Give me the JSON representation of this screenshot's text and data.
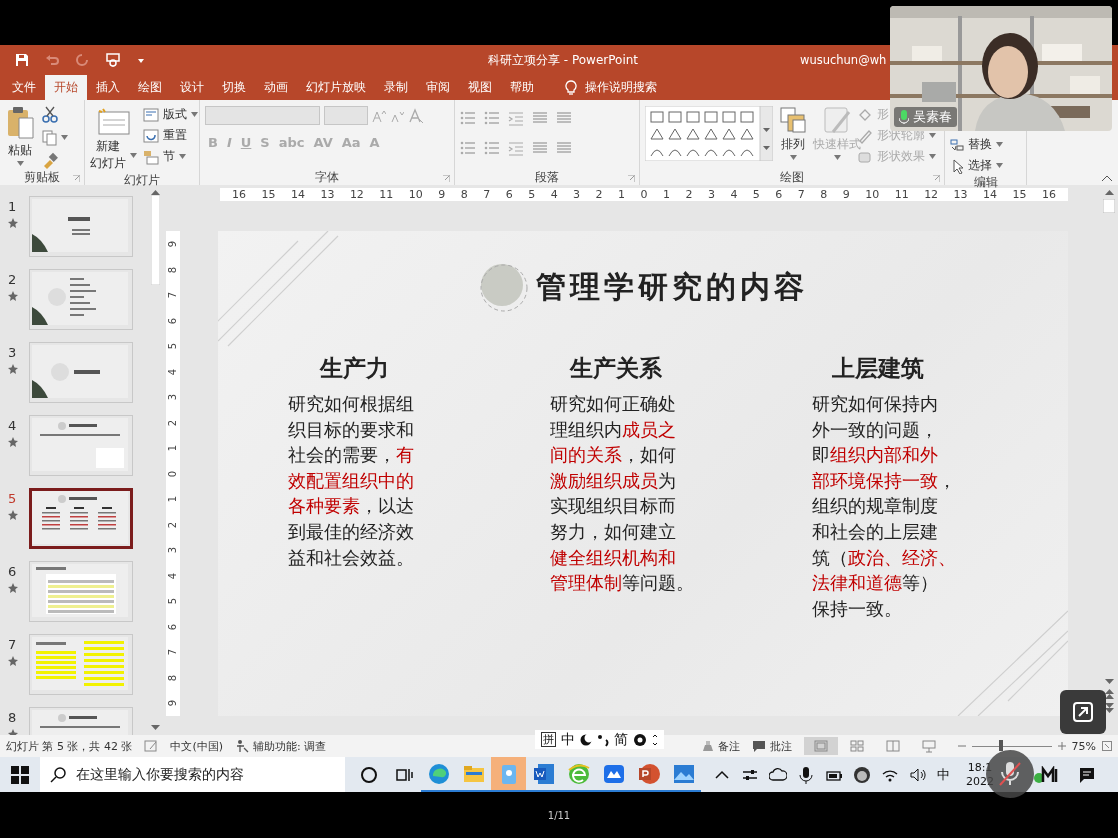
{
  "title_bar": {
    "title": "科研立项分享 - PowerPoint",
    "account": "wusuchun@wh"
  },
  "tabs": [
    {
      "label": "文件",
      "selected": false
    },
    {
      "label": "开始",
      "selected": true
    },
    {
      "label": "插入",
      "selected": false
    },
    {
      "label": "绘图",
      "selected": false
    },
    {
      "label": "设计",
      "selected": false
    },
    {
      "label": "切换",
      "selected": false
    },
    {
      "label": "动画",
      "selected": false
    },
    {
      "label": "幻灯片放映",
      "selected": false
    },
    {
      "label": "录制",
      "selected": false
    },
    {
      "label": "审阅",
      "selected": false
    },
    {
      "label": "视图",
      "selected": false
    },
    {
      "label": "帮助",
      "selected": false
    }
  ],
  "tell_me": "操作说明搜索",
  "ribbon": {
    "groups": [
      {
        "label": "剪贴板",
        "buttons": [
          {
            "label": "粘贴",
            "disabled": false
          }
        ]
      },
      {
        "label": "幻灯片",
        "buttons": [
          {
            "lines": [
              "新建",
              "幻灯片"
            ],
            "disabled": false
          },
          {
            "label": "版式",
            "disabled": false
          },
          {
            "label": "重置",
            "disabled": false
          },
          {
            "label": "节",
            "disabled": false
          }
        ]
      },
      {
        "label": "字体",
        "buttons": [
          {
            "label": "B",
            "disabled": true
          },
          {
            "label": "I",
            "disabled": true
          },
          {
            "label": "U",
            "disabled": true
          },
          {
            "label": "S",
            "disabled": true
          },
          {
            "label": "abc",
            "disabled": true
          },
          {
            "label": "AV",
            "disabled": true
          },
          {
            "label": "Aa",
            "disabled": true
          },
          {
            "label": "A",
            "disabled": true
          }
        ]
      },
      {
        "label": "段落"
      },
      {
        "label": "绘图",
        "buttons": [
          {
            "label": "排列",
            "disabled": false
          },
          {
            "label": "快速样式",
            "disabled": true
          },
          {
            "label": "形",
            "disabled": true
          },
          {
            "label": "形状轮廓",
            "disabled": true
          },
          {
            "label": "形状效果",
            "disabled": true
          }
        ]
      },
      {
        "label": "编辑",
        "buttons": [
          {
            "label": "替换",
            "disabled": false
          },
          {
            "label": "选择",
            "disabled": false
          }
        ]
      }
    ]
  },
  "ruler": {
    "horizontal": [
      "16",
      "15",
      "14",
      "13",
      "12",
      "11",
      "10",
      "9",
      "8",
      "7",
      "6",
      "5",
      "4",
      "3",
      "2",
      "1",
      "0",
      "1",
      "2",
      "3",
      "4",
      "5",
      "6",
      "7",
      "8",
      "9",
      "10",
      "11",
      "12",
      "13",
      "14",
      "15",
      "16"
    ],
    "vertical": [
      "9",
      "8",
      "7",
      "6",
      "5",
      "4",
      "3",
      "2",
      "1",
      "0",
      "1",
      "2",
      "3",
      "4",
      "5",
      "6",
      "7",
      "8",
      "9"
    ]
  },
  "thumbnails": [
    {
      "number": "1",
      "kind": "title",
      "selected": false
    },
    {
      "number": "2",
      "kind": "agenda",
      "selected": false
    },
    {
      "number": "3",
      "kind": "section",
      "selected": false
    },
    {
      "number": "4",
      "kind": "content",
      "selected": false
    },
    {
      "number": "5",
      "kind": "columns",
      "selected": true
    },
    {
      "number": "6",
      "kind": "text",
      "selected": false
    },
    {
      "number": "7",
      "kind": "highlight",
      "selected": false
    },
    {
      "number": "8",
      "kind": "content",
      "selected": false
    }
  ],
  "slide": {
    "title": "管理学研究的内容",
    "columns": [
      {
        "heading": "生产力",
        "lines": [
          "研究如何根据组",
          "织目标的要求和",
          "社会的需要，**有**",
          "**效配置组织中的**",
          "**各种要素**，以达",
          "到最佳的经济效",
          "益和社会效益。"
        ]
      },
      {
        "heading": "生产关系",
        "lines": [
          "研究如何正确处",
          "理组织内**成员之**",
          "**间的关系**，如何",
          "**激励组织成员**为",
          "实现组织目标而",
          "努力，如何建立",
          "**健全组织机构和**",
          "**管理体制**等问题。"
        ]
      },
      {
        "heading": "上层建筑",
        "lines": [
          "研究如何保持内",
          "外一致的问题，",
          "即**组织内部和外**",
          "**部环境保持一致**，",
          "组织的规章制度",
          "和社会的上层建",
          "筑（**政治、经济、**",
          "**法律和道德**等）",
          "保持一致。"
        ]
      }
    ]
  },
  "status_bar": {
    "slide_info": "幻灯片 第 5 张，共 42 张",
    "language": "中文(中国)",
    "accessibility": "辅助功能: 调查",
    "notes": "备注",
    "comments": "批注",
    "views": [
      {
        "selected": true
      },
      {
        "selected": false
      },
      {
        "selected": false
      },
      {
        "selected": false
      }
    ],
    "zoom": {
      "level": 0.37,
      "reading": "75%"
    }
  },
  "ime_bar": {
    "mode": "拼",
    "language": "中",
    "script": "简"
  },
  "taskbar": {
    "search_placeholder": "在这里输入你要搜索的内容",
    "input_method": "中",
    "time": "18:1",
    "date": "2022"
  },
  "camera": {
    "name": "吴素春"
  },
  "footer": {
    "page": "1/11"
  }
}
